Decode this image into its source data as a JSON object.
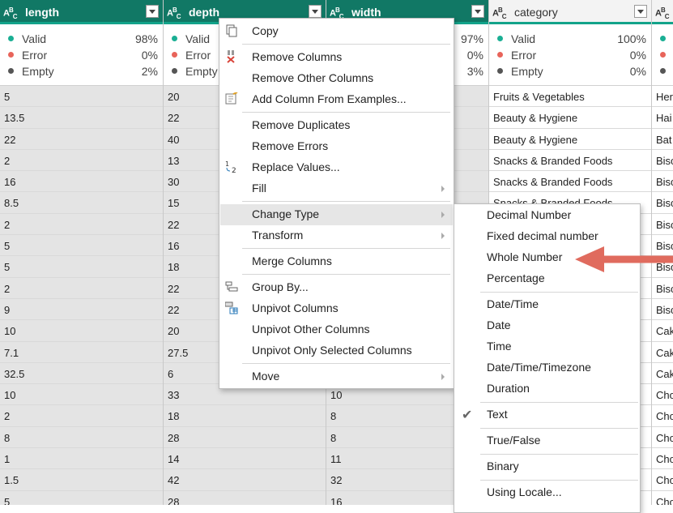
{
  "columns": [
    {
      "name": "length",
      "type_icon": "ABC",
      "selected": true,
      "quality": {
        "valid": "98%",
        "error": "0%",
        "empty": "2%"
      },
      "values": [
        "5",
        "13.5",
        "22",
        "2",
        "16",
        "8.5",
        "2",
        "5",
        "5",
        "2",
        "9",
        "10",
        "7.1",
        "32.5",
        "10",
        "2",
        "8",
        "1",
        "1.5",
        "5"
      ]
    },
    {
      "name": "depth",
      "type_icon": "ABC",
      "selected": true,
      "quality": {
        "valid": "",
        "error": "",
        "empty": ""
      },
      "values": [
        "20",
        "22",
        "40",
        "13",
        "30",
        "15",
        "22",
        "16",
        "18",
        "22",
        "22",
        "20",
        "27.5",
        "6",
        "33",
        "18",
        "28",
        "14",
        "42",
        "28"
      ]
    },
    {
      "name": "width",
      "type_icon": "ABC",
      "selected": true,
      "quality": {
        "valid": "97%",
        "error": "0%",
        "empty": "3%"
      },
      "values": [
        "",
        "",
        "",
        "",
        "",
        "",
        "",
        "",
        "",
        "",
        "",
        "",
        "",
        "",
        "10",
        "8",
        "8",
        "11",
        "32",
        "16"
      ]
    },
    {
      "name": "category",
      "type_icon": "ABC",
      "selected": false,
      "quality": {
        "valid": "100%",
        "error": "0%",
        "empty": "0%"
      },
      "values": [
        "Fruits & Vegetables",
        "Beauty & Hygiene",
        "Beauty & Hygiene",
        "Snacks & Branded Foods",
        "Snacks & Branded Foods",
        "Snacks & Branded Foods",
        "",
        "",
        "",
        "",
        "",
        "",
        "",
        "",
        "",
        "",
        "",
        "",
        "",
        ""
      ]
    },
    {
      "name": "",
      "type_icon": "ABC",
      "selected": false,
      "quality": {
        "valid": "",
        "error": "",
        "empty": ""
      },
      "values": [
        "Her",
        "Hai",
        "Bat",
        "Bisc",
        "Bisc",
        "Bisc",
        "Bisc",
        "Bisc",
        "Bisc",
        "Bisc",
        "Bisc",
        "Cak",
        "Cak",
        "Cak",
        "Cho",
        "Cho",
        "Cho",
        "Cho",
        "Cho",
        "Cho"
      ]
    }
  ],
  "quality_labels": {
    "valid": "Valid",
    "error": "Error",
    "empty": "Empty"
  },
  "colors": {
    "header": "#117865",
    "accent": "#13a38a",
    "valid": "#1aaf94",
    "error": "#e8645a",
    "empty": "#555555",
    "arrow": "#e06b5e"
  },
  "context_menu": {
    "items": [
      "Copy",
      "Remove Columns",
      "Remove Other Columns",
      "Add Column From Examples...",
      "Remove Duplicates",
      "Remove Errors",
      "Replace Values...",
      "Fill",
      "Change Type",
      "Transform",
      "Merge Columns",
      "Group By...",
      "Unpivot Columns",
      "Unpivot Other Columns",
      "Unpivot Only Selected Columns",
      "Move"
    ],
    "highlighted": "Change Type"
  },
  "submenu": {
    "items": [
      "Decimal Number",
      "Fixed decimal number",
      "Whole Number",
      "Percentage",
      "Date/Time",
      "Date",
      "Time",
      "Date/Time/Timezone",
      "Duration",
      "Text",
      "True/False",
      "Binary",
      "Using Locale..."
    ],
    "checked": "Text"
  }
}
